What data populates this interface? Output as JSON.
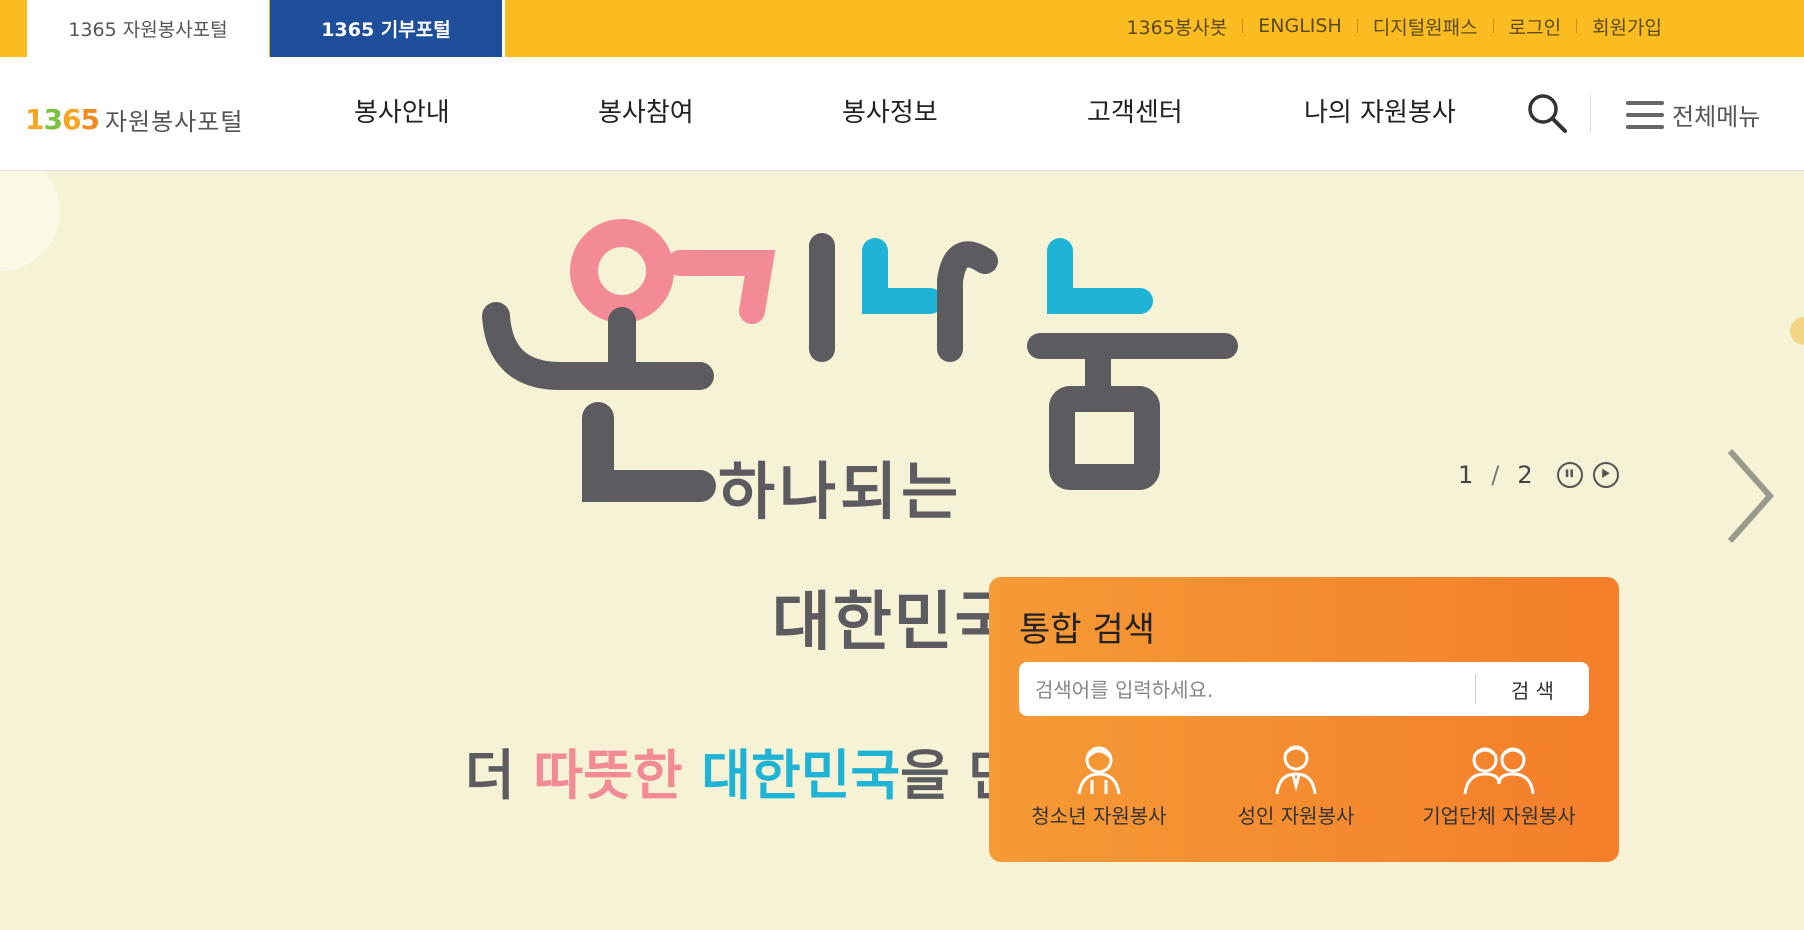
{
  "topbar": {
    "tabs": [
      {
        "label": "1365 자원봉사포털"
      },
      {
        "label": "1365 기부포털"
      }
    ],
    "util_links": [
      "1365봉사봇",
      "ENGLISH",
      "디지털원패스",
      "로그인",
      "회원가입"
    ]
  },
  "nav": {
    "logo": {
      "number": "1365",
      "text": "자원봉사포털"
    },
    "menu": [
      "봉사안내",
      "봉사참여",
      "봉사정보",
      "고객센터",
      "나의 자원봉사"
    ],
    "all_menu_label": "전체메뉴"
  },
  "hero": {
    "slide_current": "1",
    "slide_separator": "/",
    "slide_total": "2",
    "banner": {
      "title_main": "온기나눔",
      "title_sub": "하나되는",
      "title_country": "대한민국",
      "slogan_parts": [
        "더 ",
        "따뜻한 ",
        "대한민국",
        "을 만듭니다!"
      ]
    }
  },
  "search_panel": {
    "title": "통합 검색",
    "placeholder": "검색어를 입력하세요.",
    "button_label": "검 색",
    "categories": [
      {
        "label": "청소년 자원봉사",
        "icon": "youth-icon"
      },
      {
        "label": "성인 자원봉사",
        "icon": "adult-icon"
      },
      {
        "label": "기업단체 자원봉사",
        "icon": "group-icon"
      }
    ]
  },
  "colors": {
    "topbar_bg": "#fbbc22",
    "donation_tab_bg": "#1f4f9a",
    "panel_bg": "#f58c30",
    "hero_bg": "#f6f2d6",
    "pink": "#f28b95",
    "blue": "#1fb3d6",
    "gray": "#5b5b60"
  }
}
